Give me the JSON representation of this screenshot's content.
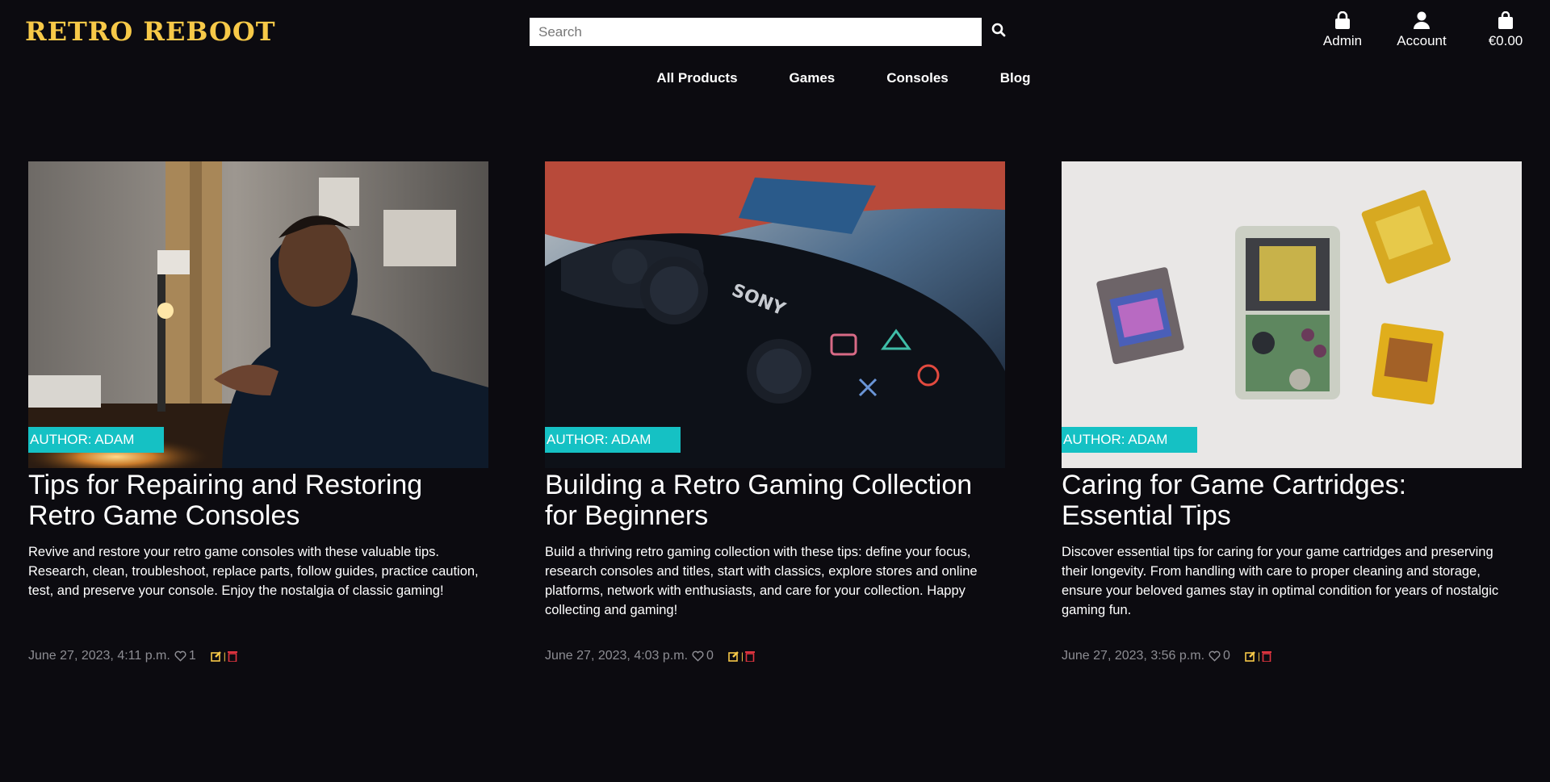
{
  "header": {
    "logo": "RETRO REBOOT",
    "search_placeholder": "Search",
    "links": {
      "admin": "Admin",
      "account": "Account",
      "cart": "€0.00"
    }
  },
  "nav": [
    "All Products",
    "Games",
    "Consoles",
    "Blog"
  ],
  "posts": [
    {
      "author": "AUTHOR: ADAM",
      "title": "Tips for Repairing and Restoring Retro Game Consoles",
      "description": "Revive and restore your retro game consoles with these valuable tips. Research, clean, troubleshoot, replace parts, follow guides, practice caution, test, and preserve your console. Enjoy the nostalgia of classic gaming!",
      "date": "June 27, 2023, 4:11 p.m.",
      "likes": "1"
    },
    {
      "author": "AUTHOR: ADAM",
      "title": "Building a Retro Gaming Collection for Beginners",
      "description": "Build a thriving retro gaming collection with these tips: define your focus, research consoles and titles, start with classics, explore stores and online platforms, network with enthusiasts, and care for your collection. Happy collecting and gaming!",
      "date": "June 27, 2023, 4:03 p.m.",
      "likes": "0"
    },
    {
      "author": "AUTHOR: ADAM",
      "title": "Caring for Game Cartridges: Essential Tips",
      "description": "Discover essential tips for caring for your game cartridges and preserving their longevity. From handling with care to proper cleaning and storage, ensure your beloved games stay in optimal condition for years of nostalgic gaming fun.",
      "date": "June 27, 2023, 3:56 p.m.",
      "likes": "0"
    }
  ],
  "colors": {
    "accent": "#f7c948",
    "author_badge": "#15c1c4",
    "background": "#0c0b10",
    "delete": "#e0343f"
  },
  "icons": {
    "search": "search-icon",
    "admin": "lock-icon",
    "account": "user-icon",
    "cart": "shopping-bag-icon",
    "like": "heart-icon",
    "edit": "edit-icon",
    "delete": "trash-icon"
  }
}
